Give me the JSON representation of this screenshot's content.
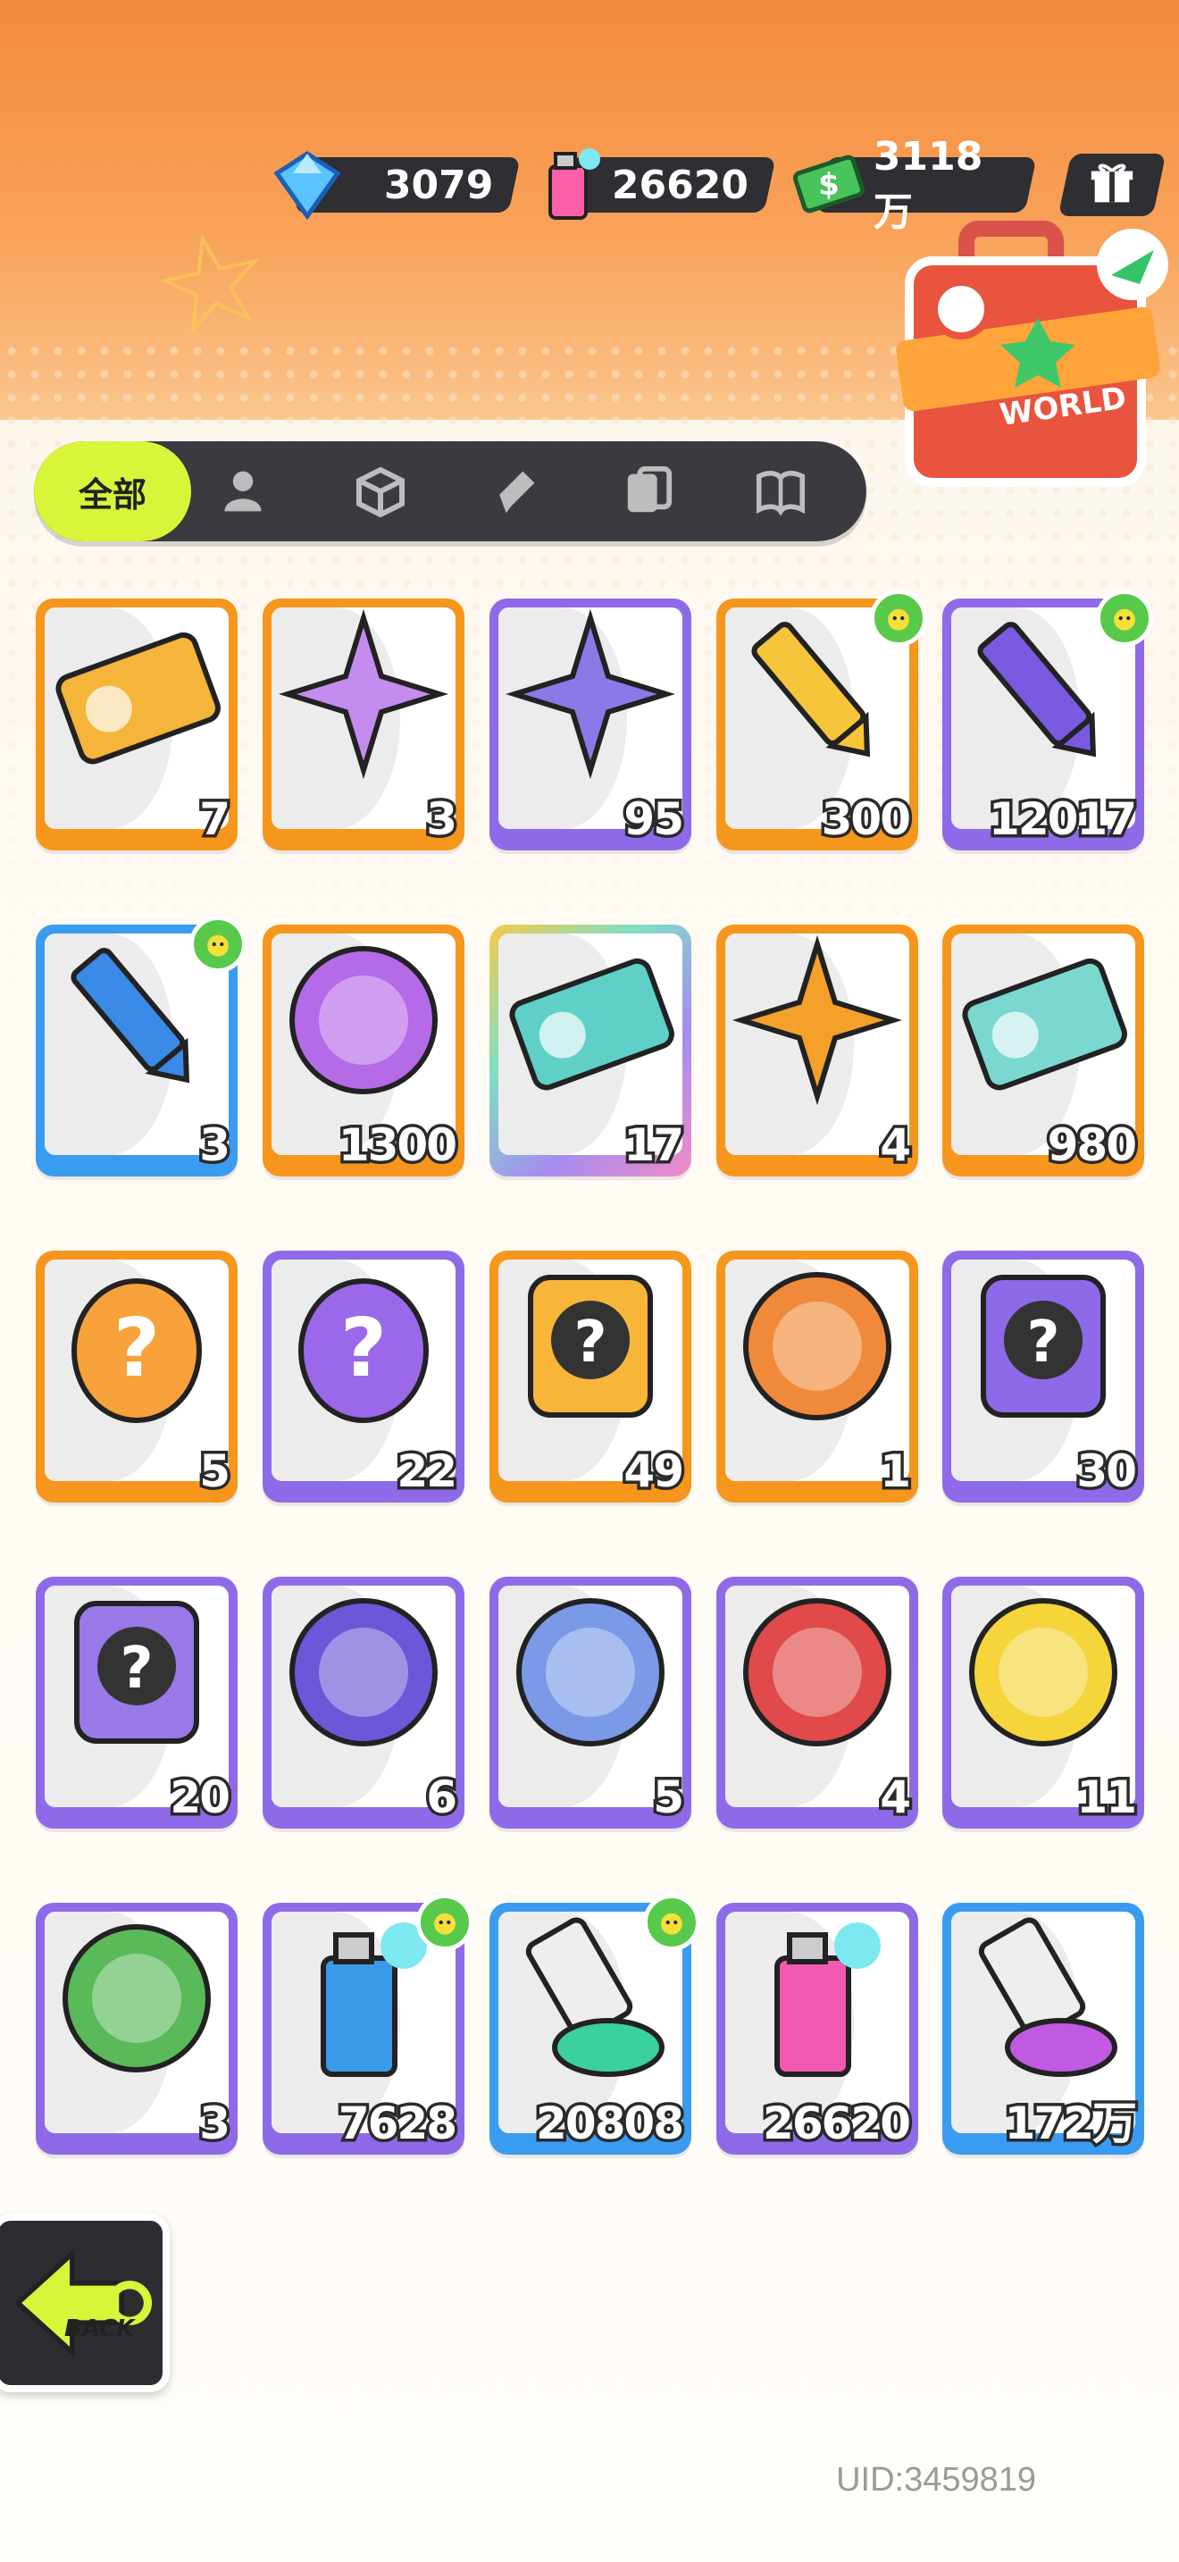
{
  "currency": {
    "gems": "3079",
    "paint": "26620",
    "cash": "3118万"
  },
  "world_button": {
    "label": "WORLD"
  },
  "tabs": {
    "all_label": "全部",
    "icons": [
      "person-icon",
      "box-icon",
      "pen-icon",
      "card-icon",
      "book-icon"
    ]
  },
  "items": [
    {
      "name": "ticket",
      "count": "7",
      "frame": "orange"
    },
    {
      "name": "rainbow-star",
      "count": "3",
      "frame": "orange"
    },
    {
      "name": "purple-star",
      "count": "95",
      "frame": "purple"
    },
    {
      "name": "yellow-crayon",
      "count": "300",
      "frame": "orange",
      "badge": true
    },
    {
      "name": "purple-crayon",
      "count": "12017",
      "frame": "purple",
      "badge": true
    },
    {
      "name": "blue-crayon",
      "count": "3",
      "frame": "blue",
      "badge": true
    },
    {
      "name": "cool-badge",
      "count": "1300",
      "frame": "orange"
    },
    {
      "name": "lottery-ticket",
      "count": "17",
      "frame": "rainbow"
    },
    {
      "name": "star-badge",
      "count": "4",
      "frame": "orange"
    },
    {
      "name": "season-ticket",
      "count": "980",
      "frame": "orange"
    },
    {
      "name": "orange-mystery-egg",
      "count": "5",
      "frame": "orange"
    },
    {
      "name": "purple-mystery-egg",
      "count": "22",
      "frame": "purple"
    },
    {
      "name": "deity-mystery-orange",
      "count": "49",
      "frame": "orange"
    },
    {
      "name": "octopus-pet",
      "count": "1",
      "frame": "orange"
    },
    {
      "name": "deity-mystery-purple",
      "count": "30",
      "frame": "purple"
    },
    {
      "name": "travel-card",
      "count": "20",
      "frame": "purple"
    },
    {
      "name": "bat-pet",
      "count": "6",
      "frame": "purple"
    },
    {
      "name": "fish-pet",
      "count": "5",
      "frame": "purple"
    },
    {
      "name": "piranha-pet",
      "count": "4",
      "frame": "purple"
    },
    {
      "name": "jelly-pet",
      "count": "11",
      "frame": "purple"
    },
    {
      "name": "plant-pet",
      "count": "3",
      "frame": "purple"
    },
    {
      "name": "spray-blue",
      "count": "7628",
      "frame": "purple",
      "badge": true
    },
    {
      "name": "paint-tube-blue",
      "count": "20808",
      "frame": "blue",
      "badge": true
    },
    {
      "name": "spray-pink",
      "count": "26620",
      "frame": "purple"
    },
    {
      "name": "paint-tube-purple",
      "count": "172万",
      "frame": "blue"
    }
  ],
  "back_button": {
    "label": "BACK"
  },
  "uid": "UID:3459819"
}
